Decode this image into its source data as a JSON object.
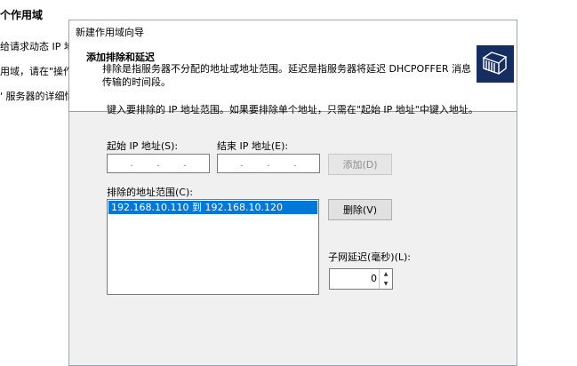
{
  "background": {
    "title": "个作用域",
    "line1": "给请求动态 IP 地",
    "line2": "用域，请在\"操作\"",
    "line3": "' 服务器的详细情"
  },
  "dialog": {
    "title": "新建作用域向导",
    "header_title": "添加排除和延迟",
    "header_desc": "排除是指服务器不分配的地址或地址范围。延迟是指服务器将延迟 DHCPOFFER 消息传输的时间段。",
    "header_icon": "folders-icon",
    "instruction": "键入要排除的 IP 地址范围。如果要排除单个地址，只需在\"起始 IP 地址\"中键入地址。",
    "start_ip_label": "起始 IP 地址(S):",
    "end_ip_label": "结束 IP 地址(E):",
    "start_ip_value": "",
    "end_ip_value": "",
    "add_button": "添加(D)",
    "excluded_label": "排除的地址范围(C):",
    "excluded_items": [
      "192.168.10.110 到 192.168.10.120"
    ],
    "remove_button": "删除(V)",
    "delay_label": "子网延迟(毫秒)(L):",
    "delay_value": "0",
    "accent_color": "#0078d7",
    "icon_bg_color": "#162d62"
  }
}
